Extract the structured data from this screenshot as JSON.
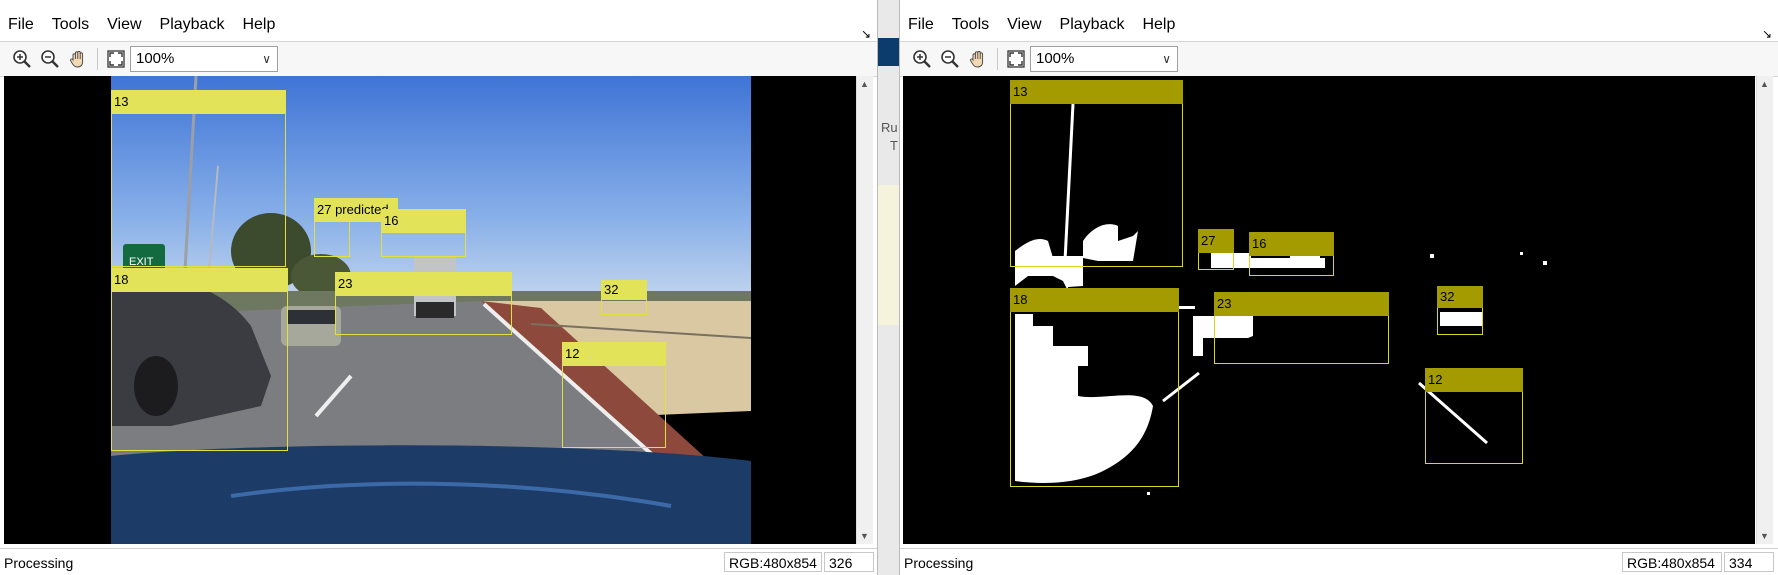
{
  "menu": [
    "File",
    "Tools",
    "View",
    "Playback",
    "Help"
  ],
  "toolbar": {
    "zoom_in_icon": "zoom-in-icon",
    "zoom_out_icon": "zoom-out-icon",
    "pan_icon": "hand-pan-icon",
    "fit_icon": "fit-to-window-icon",
    "zoom_value": "100%"
  },
  "left_player": {
    "status": "Processing",
    "image_info": "RGB:480x854",
    "frame": "326",
    "boxes": [
      {
        "label": "13"
      },
      {
        "label": "27 predicted"
      },
      {
        "label": "16"
      },
      {
        "label": "18"
      },
      {
        "label": "23"
      },
      {
        "label": "32"
      },
      {
        "label": "12"
      }
    ]
  },
  "right_player": {
    "status": "Processing",
    "image_info": "RGB:480x854",
    "frame": "334",
    "boxes": [
      {
        "label": "13"
      },
      {
        "label": "27"
      },
      {
        "label": "16"
      },
      {
        "label": "18"
      },
      {
        "label": "23"
      },
      {
        "label": "32"
      },
      {
        "label": "12"
      }
    ]
  },
  "background_window": {
    "text_1": "Ru",
    "text_2": "T"
  },
  "colors": {
    "left_box": "#e3e35a",
    "right_box_label": "#a39b00",
    "viewport_bg": "#000000",
    "sky": "#5a8ee0",
    "road": "#7a7a7a"
  }
}
